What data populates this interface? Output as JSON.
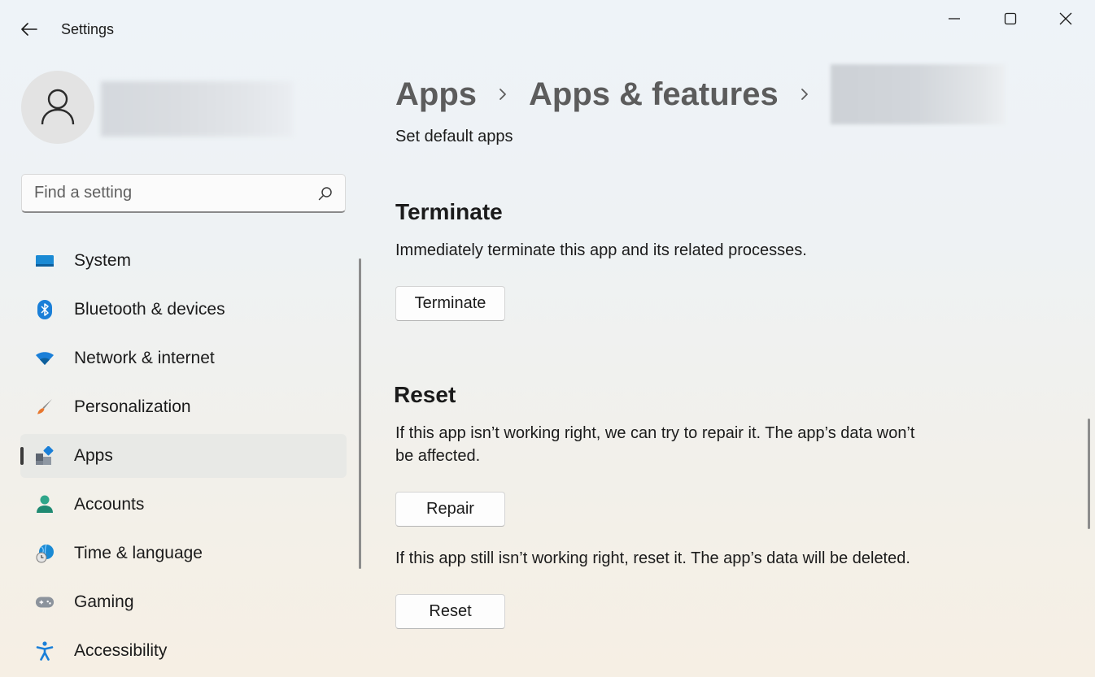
{
  "window": {
    "title": "Settings",
    "controls": {
      "minimize": "minimize-icon",
      "maximize": "maximize-icon",
      "close": "close-icon"
    }
  },
  "sidebar": {
    "search_placeholder": "Find a setting",
    "items": [
      {
        "label": "System",
        "icon": "system-icon",
        "selected": false
      },
      {
        "label": "Bluetooth & devices",
        "icon": "bluetooth-icon",
        "selected": false
      },
      {
        "label": "Network & internet",
        "icon": "wifi-icon",
        "selected": false
      },
      {
        "label": "Personalization",
        "icon": "paintbrush-icon",
        "selected": false
      },
      {
        "label": "Apps",
        "icon": "apps-icon",
        "selected": true
      },
      {
        "label": "Accounts",
        "icon": "person-icon",
        "selected": false
      },
      {
        "label": "Time & language",
        "icon": "globe-clock-icon",
        "selected": false
      },
      {
        "label": "Gaming",
        "icon": "gamepad-icon",
        "selected": false
      },
      {
        "label": "Accessibility",
        "icon": "accessibility-icon",
        "selected": false
      }
    ]
  },
  "main": {
    "breadcrumb": [
      "Apps",
      "Apps & features"
    ],
    "default_apps_link": "Set default apps",
    "terminate": {
      "title": "Terminate",
      "description": "Immediately terminate this app and its related processes.",
      "button": "Terminate"
    },
    "reset": {
      "title": "Reset",
      "repair_description": "If this app isn’t working right, we can try to repair it. The app’s data won’t be affected.",
      "repair_button": "Repair",
      "reset_description": "If this app still isn’t working right, reset it. The app’s data will be deleted.",
      "reset_button": "Reset"
    }
  },
  "colors": {
    "accent": "#0067c0",
    "selected_bg": "#e8e9e6"
  }
}
